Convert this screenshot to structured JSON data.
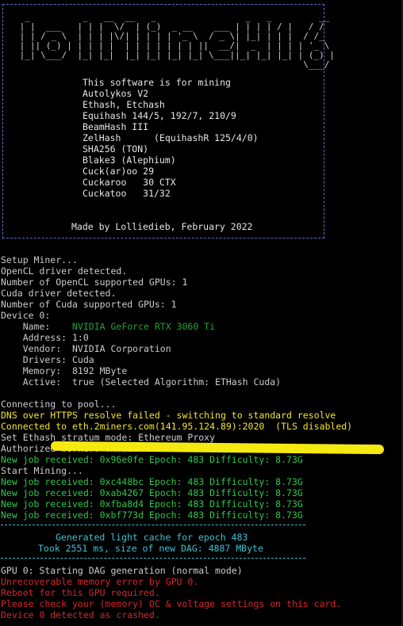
{
  "banner": {
    "logo_text": "lolMiner",
    "info_lines": [
      "This software is for mining",
      "Autolykos V2",
      "Ethash, Etchash",
      "Equihash 144/5, 192/7, 210/9",
      "BeamHash III",
      "ZelHash      (EquihashR 125/4/0)",
      "SHA256 (TON)",
      "Blake3 (Alephium)",
      "Cuck(ar)oo 29",
      "Cuckaroo   30 CTX",
      "Cuckatoo   31/32"
    ],
    "credit": "Made by Lolliedieb, February 2022"
  },
  "setup": {
    "lines": [
      "Setup Miner...",
      "OpenCL driver detected.",
      "Number of OpenCL supported GPUs: 1",
      "Cuda driver detected.",
      "Number of Cuda supported GPUs: 1",
      "Device 0:"
    ],
    "name_label": "    Name:    ",
    "name_value": "NVIDIA GeForce RTX 3060 Ti",
    "detail_lines": [
      "    Address: 1:0",
      "    Vendor:  NVIDIA Corporation",
      "    Drivers: Cuda",
      "    Memory:  8192 MByte",
      "    Active:  true (Selected Algorithm: ETHash Cuda)"
    ]
  },
  "pool": {
    "connecting": "Connecting to pool...",
    "dns_warning": "DNS over HTTPS resolve failed - switching to standard resolve",
    "connected": "Connected to eth.2miners.com(141.95.124.89):2020  (TLS disabled)",
    "stratum": "Set Ethash stratum mode: Ethereum Proxy",
    "authorized": "Authorized worker: 0x0112e0190536f4d49a01c6f17e0fa0e5BC"
  },
  "jobs": {
    "first": "New job received: 0x96e0fe Epoch: 483 Difficulty: 8.73G",
    "start": "Start Mining...",
    "list": [
      "New job received: 0xc448bc Epoch: 483 Difficulty: 8.73G",
      "New job received: 0xab4267 Epoch: 483 Difficulty: 8.73G",
      "New job received: 0xfba8d4 Epoch: 483 Difficulty: 8.73G",
      "New job received: 0xbf773d Epoch: 483 Difficulty: 8.73G"
    ]
  },
  "dag": {
    "line1": "Generated light cache for epoch 483",
    "line2": "Took 2551 ms, size of new DAG: 4887 MByte"
  },
  "errors": {
    "start": "GPU 0: Starting DAG generation (normal mode)",
    "lines": [
      "Unrecoverable memory error by GPU 0.",
      "Reboot for this GPU required.",
      "Please check your (memory) OC & voltage settings on this card.",
      "Device 0 detected as crashed."
    ]
  },
  "colors": {
    "background": "#000000",
    "text": "#cccccc",
    "warning": "#f2e533",
    "success": "#2ec84a",
    "info": "#3ec1d3",
    "error": "#d8242b"
  }
}
